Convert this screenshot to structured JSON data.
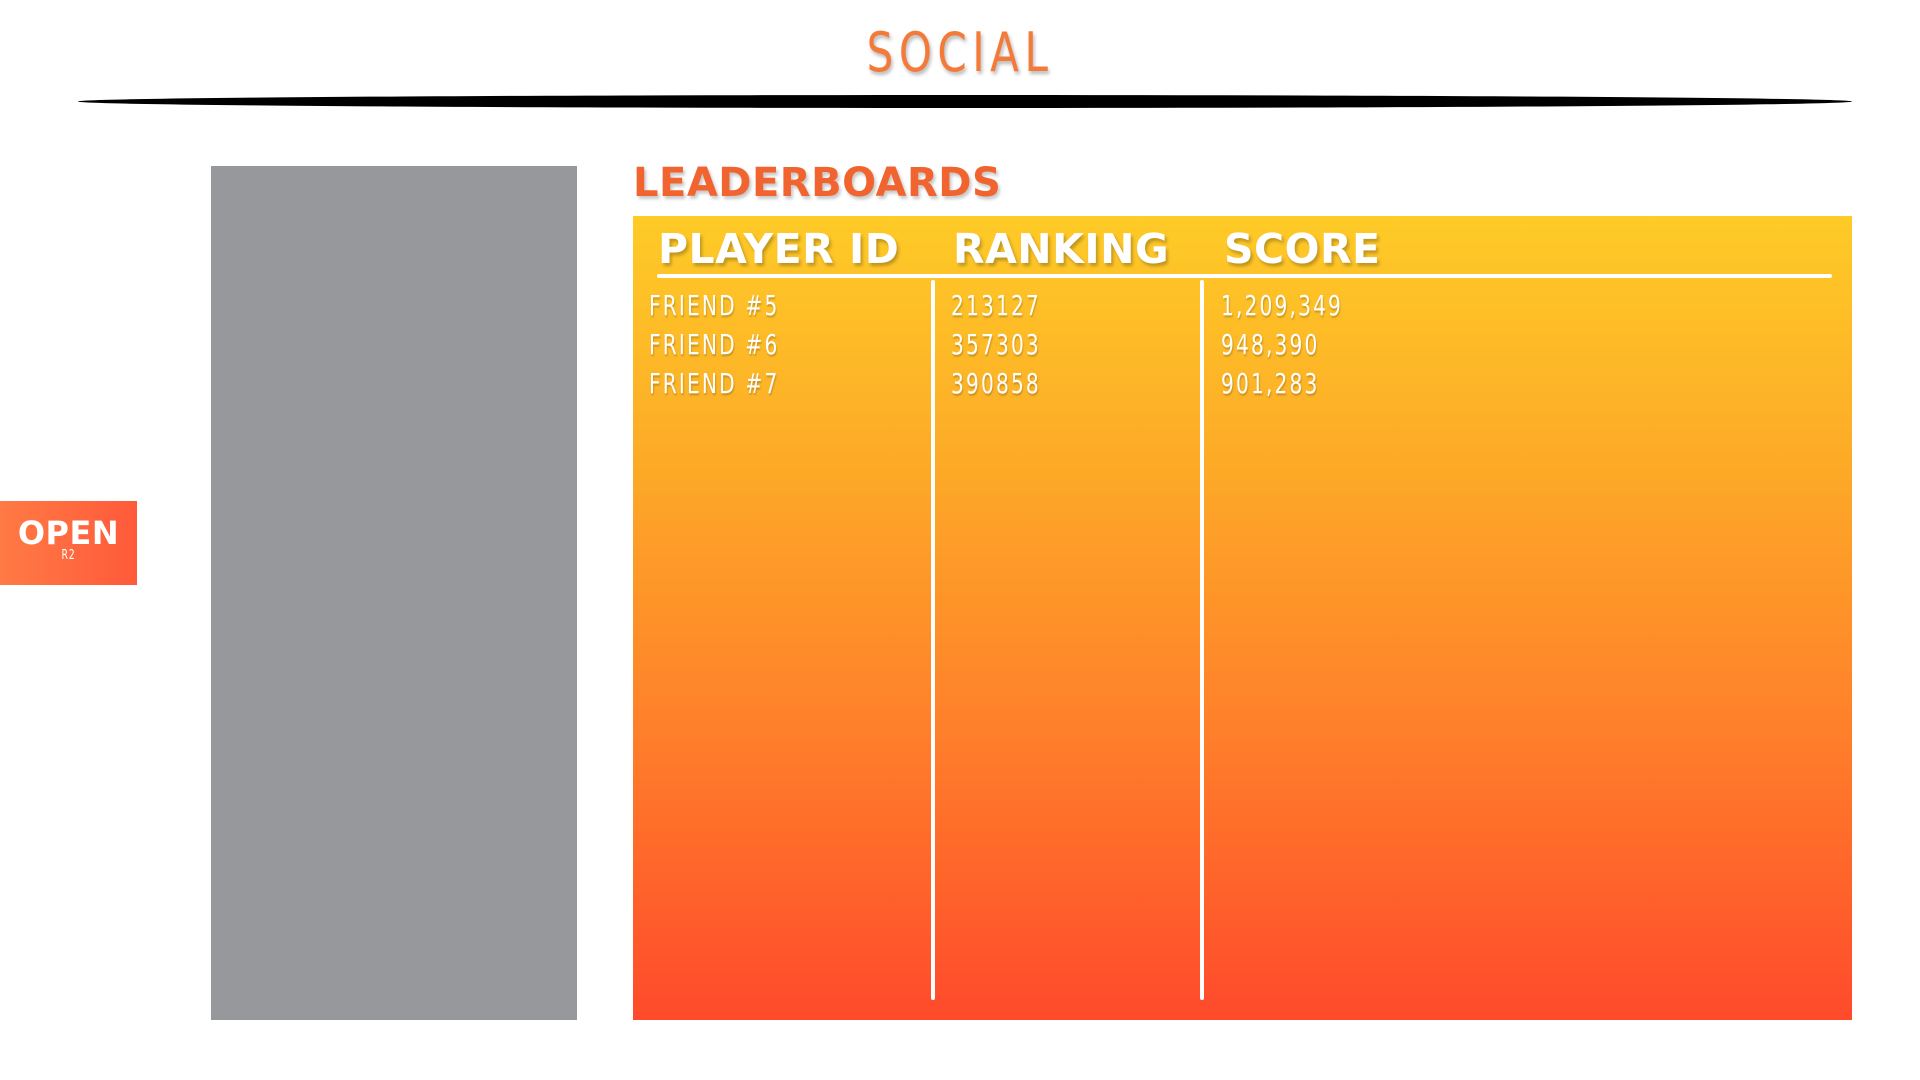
{
  "header": {
    "title": "SOCIAL"
  },
  "open_tab": {
    "label": "OPEN",
    "sublabel": "R2"
  },
  "leaderboards": {
    "title": "LEADERBOARDS",
    "columns": [
      "PLAYER ID",
      "RANKING",
      "SCORE"
    ],
    "rows": [
      [
        "FRIEND #5",
        "213127",
        "1,209,349"
      ],
      [
        "FRIEND #6",
        "357303",
        "948,390"
      ],
      [
        "FRIEND #7",
        "390858",
        "901,283"
      ]
    ]
  },
  "colors": {
    "accent": "#f47a3a",
    "board_top": "#fecb27",
    "board_bottom": "#ff4a2b",
    "side_panel": "#97989b"
  }
}
